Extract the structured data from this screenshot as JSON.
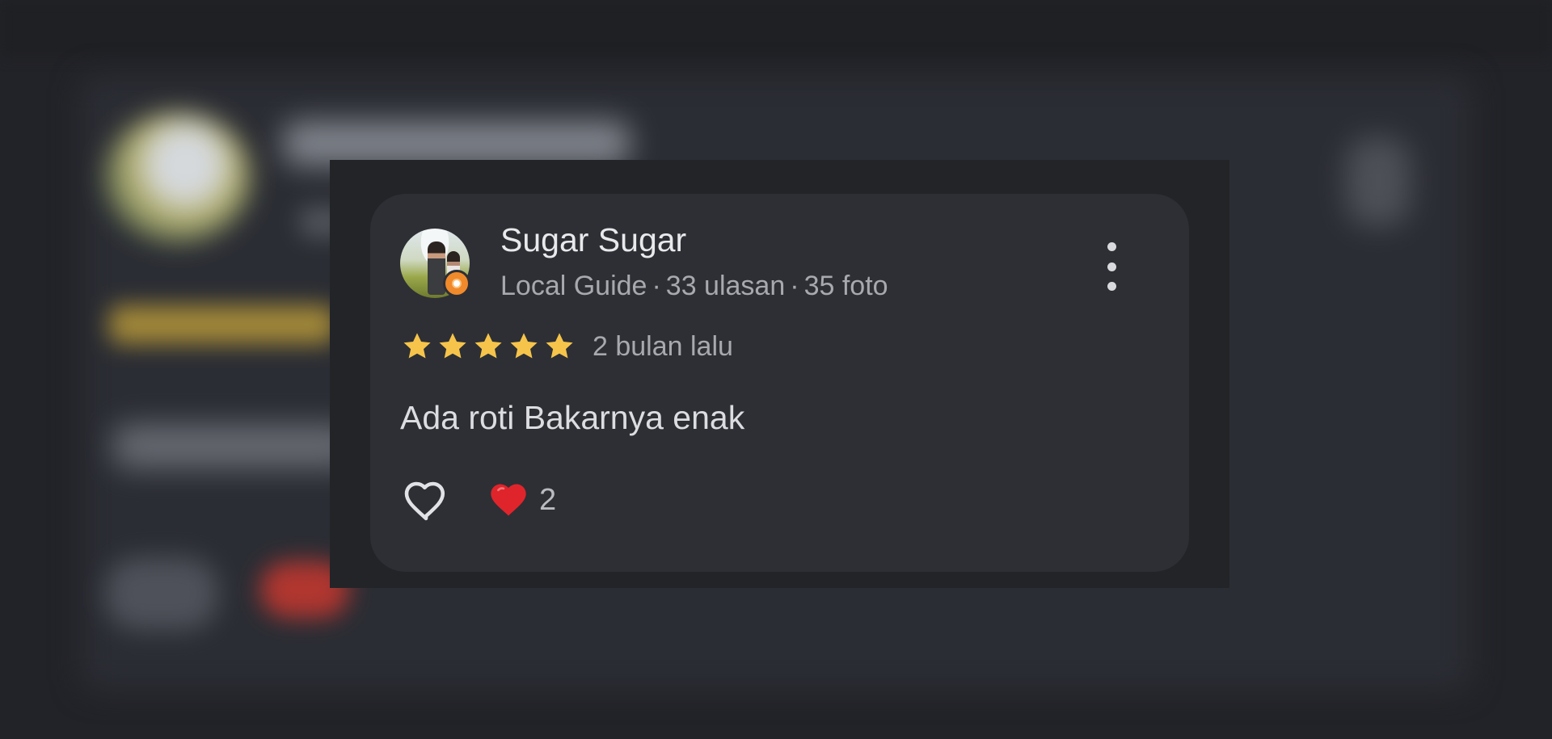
{
  "review": {
    "reviewer_name": "Sugar Sugar",
    "reviewer_role": "Local Guide",
    "reviews_count": "33 ulasan",
    "photos_count": "35 foto",
    "separator": "·",
    "rating": 5,
    "rating_max": 5,
    "time_ago": "2 bulan lalu",
    "text": "Ada roti Bakarnya enak",
    "reaction_count": "2"
  },
  "icons": {
    "avatar": "reviewer-avatar",
    "badge": "local-guide-badge-icon",
    "more": "more-vert-icon",
    "star": "star-icon",
    "like": "heart-outline-icon",
    "reaction": "red-heart-icon"
  },
  "colors": {
    "star": "#f6c44a",
    "reaction_heart": "#e0242b",
    "card_bg": "#2d2f35",
    "popup_bg": "#232428",
    "badge": "#f08a2a"
  }
}
